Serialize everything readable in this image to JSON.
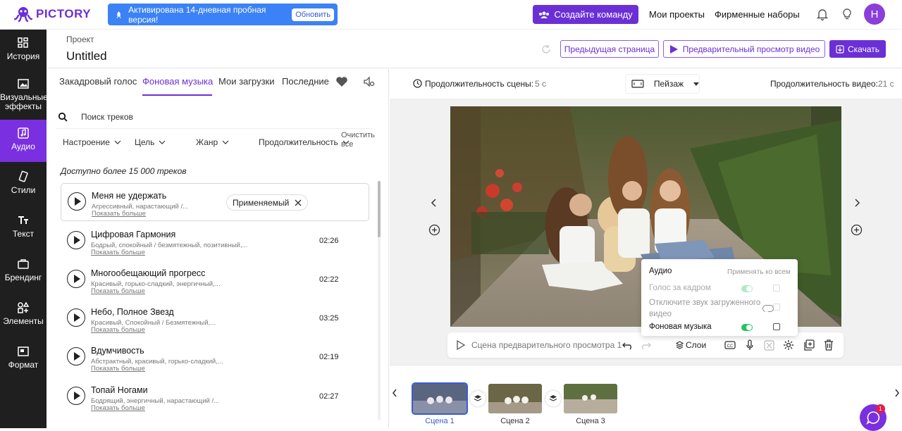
{
  "header": {
    "logo_text": "PICTORY",
    "trial_text": "Активирована 14-дневная пробная версия!",
    "upgrade_label": "Обновить",
    "create_team_label": "Создайте команду",
    "my_projects_label": "Мои проекты",
    "brand_kits_label": "Фирменные наборы",
    "avatar_initial": "H"
  },
  "sidebar": {
    "items": [
      {
        "label": "История",
        "icon": "story-icon"
      },
      {
        "label": "Визуальные эффекты",
        "icon": "visuals-icon"
      },
      {
        "label": "Аудио",
        "icon": "audio-icon",
        "active": true
      },
      {
        "label": "Стили",
        "icon": "styles-icon"
      },
      {
        "label": "Текст",
        "icon": "text-icon"
      },
      {
        "label": "Брендинг",
        "icon": "branding-icon"
      },
      {
        "label": "Элементы",
        "icon": "elements-icon"
      },
      {
        "label": "Формат",
        "icon": "format-icon"
      }
    ]
  },
  "project": {
    "label": "Проект",
    "title": "Untitled",
    "prev_page_label": "Предыдущая страница",
    "preview_label": "Предварительный просмотр видео",
    "download_label": "Скачать"
  },
  "audio_panel": {
    "tabs": [
      "Закадровый голос",
      "Фоновая музыка",
      "Мои загрузки",
      "Последние"
    ],
    "active_tab": "Фоновая музыка",
    "search_placeholder": "Поиск треков",
    "filters": [
      "Настроение",
      "Цель",
      "Жанр",
      "Продолжительность"
    ],
    "clear_all": "Очистить все",
    "available_text": "Доступно более 15 000 треков",
    "show_more": "Показать больше",
    "applied_label": "Применяемый",
    "tracks": [
      {
        "title": "Меня не удержать",
        "tags": "Агрессивный, нарастающий /...",
        "duration": "",
        "applied": true
      },
      {
        "title": "Цифровая Гармония",
        "tags": "Бодрый, спокойный / безмятежный, позитивный,...",
        "duration": "02:26"
      },
      {
        "title": "Многообещающий прогресс",
        "tags": "Красивый, горько-сладкий, энергичный,...",
        "duration": "02:22"
      },
      {
        "title": "Небо, Полное Звезд",
        "tags": "Красивый, Спокойный / Безмятежный,...",
        "duration": "03:25"
      },
      {
        "title": "Вдумчивость",
        "tags": "Абстрактный, красивый, горько-сладкий,...",
        "duration": "02:19"
      },
      {
        "title": "Топай Ногами",
        "tags": "Бодрящий, энергичный, нарастающий /...",
        "duration": "02:27"
      }
    ]
  },
  "editor": {
    "scene_duration_label": "Продолжительность сцены:",
    "scene_duration_value": "5 с",
    "layout_label": "Пейзаж",
    "video_duration_label": "Продолжительность видео:",
    "video_duration_value": "21 с",
    "preview_scene_label": "Сцена предварительного просмотра 1",
    "layers_label": "Слои"
  },
  "audio_popover": {
    "title": "Аудио",
    "apply_all_label": "Применять ко всем",
    "rows": [
      {
        "label": "Голос за кадром",
        "toggle": "disabled"
      },
      {
        "label": "Отключите звук загруженного видео",
        "toggle": "off"
      },
      {
        "label": "Фоновая музыка",
        "toggle": "on"
      }
    ]
  },
  "timeline": {
    "scenes": [
      "Сцена 1",
      "Сцена 2",
      "Сцена 3"
    ],
    "active_scene": "Сцена 1"
  },
  "chat": {
    "badge_count": "1"
  },
  "colors": {
    "brand": "#6b2fd6",
    "trial_banner": "#3b82f6",
    "sidebar": "#1f1f1f",
    "active_scene": "#3b5bd6"
  }
}
